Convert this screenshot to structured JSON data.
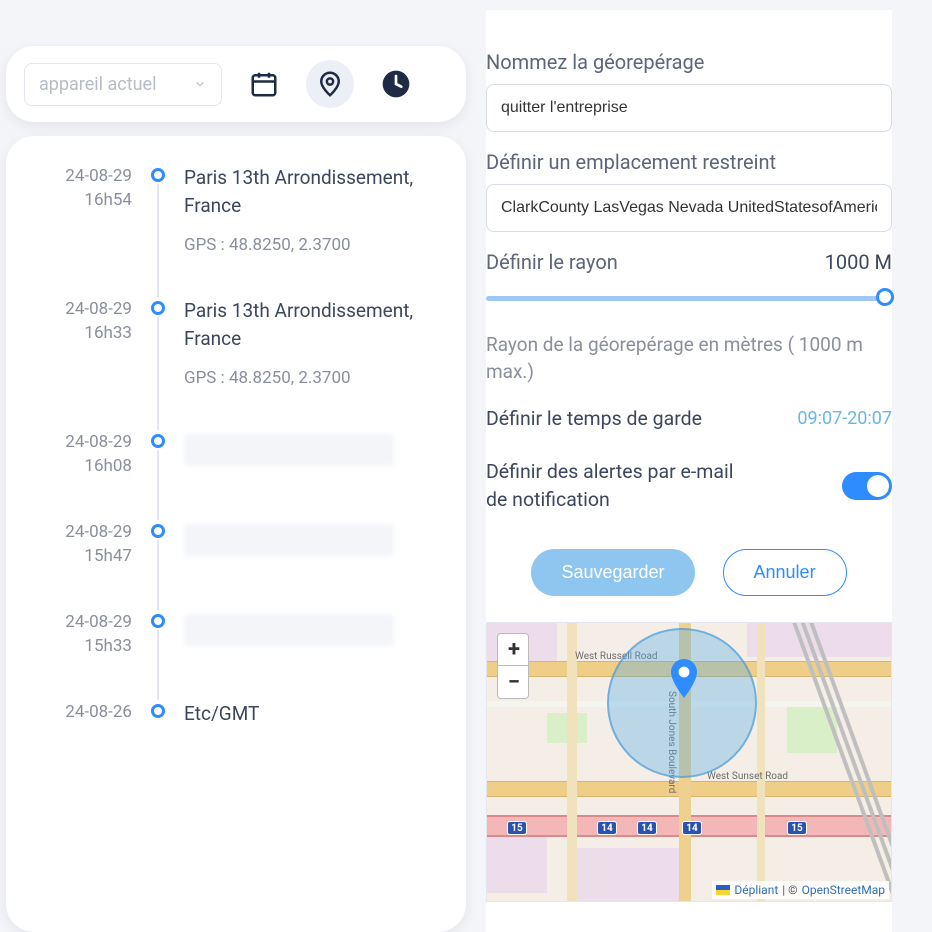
{
  "toolbar": {
    "device_select_label": "appareil actuel"
  },
  "history": [
    {
      "date": "24-08-29",
      "hour": "16h54",
      "title": "Paris 13th Arrondissement, France",
      "gps": "GPS :  48.8250, 2.3700",
      "blank": false
    },
    {
      "date": "24-08-29",
      "hour": "16h33",
      "title": "Paris 13th Arrondissement, France",
      "gps": "GPS :  48.8250, 2.3700",
      "blank": false
    },
    {
      "date": "24-08-29",
      "hour": "16h08",
      "blank": true
    },
    {
      "date": "24-08-29",
      "hour": "15h47",
      "blank": true
    },
    {
      "date": "24-08-29",
      "hour": "15h33",
      "blank": true
    },
    {
      "date": "24-08-26",
      "hour": "",
      "title": "Etc/GMT",
      "blank": false
    }
  ],
  "form": {
    "name_label": "Nommez la géorepérage",
    "name_value": "quitter l'entreprise",
    "location_label": "Définir un emplacement restreint",
    "location_value": "ClarkCounty LasVegas Nevada UnitedStatesofAmerica(tl",
    "radius_label": "Définir le rayon",
    "radius_value": "1000 M",
    "radius_hint": "Rayon de la géorepérage en mètres ( 1000 m max.)",
    "guard_label": "Définir le temps de garde",
    "guard_value": "09:07-20:07",
    "alerts_label": "Définir des alertes par e-mail de notification",
    "save_label": "Sauvegarder",
    "cancel_label": "Annuler"
  },
  "map": {
    "roads": {
      "russell": "West Russell Road",
      "sunset": "West Sunset Road",
      "jones": "South Jones Boulevard"
    },
    "hwy_labels": [
      "15",
      "14",
      "14",
      "14",
      "15"
    ],
    "attrib_leaflet": "Dépliant",
    "attrib_sep": " | © ",
    "attrib_osm": "OpenStreetMap"
  }
}
